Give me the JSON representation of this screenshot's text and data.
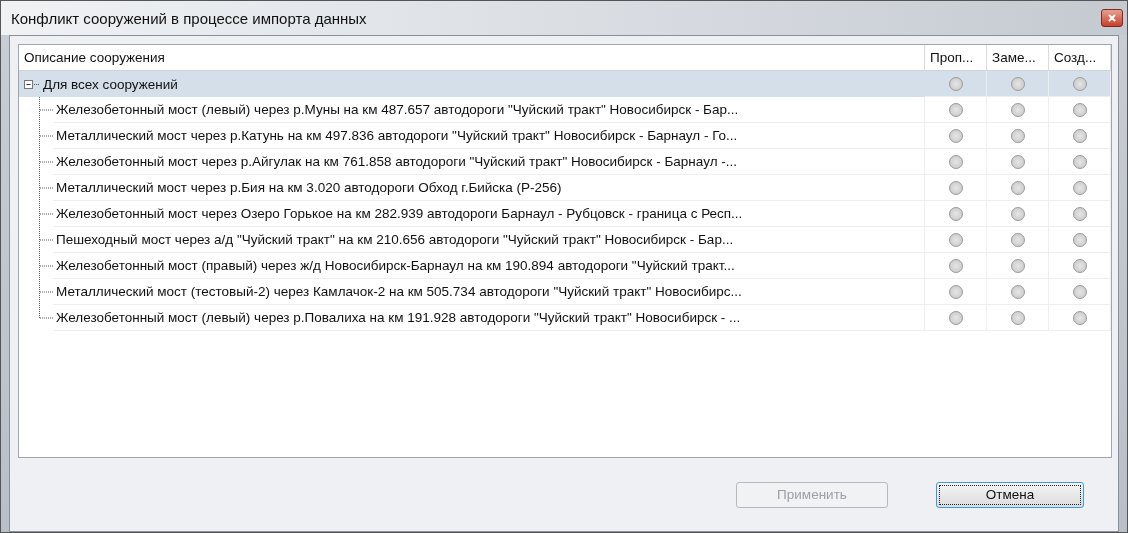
{
  "window": {
    "title": "Конфликт сооружений в процессе импорта данных"
  },
  "table": {
    "columns": [
      "Описание сооружения",
      "Проп...",
      "Заме...",
      "Созд..."
    ],
    "root": {
      "label": "Для всех сооружений",
      "expanded": true,
      "selected": true,
      "options": [
        {
          "selected": false
        },
        {
          "selected": false
        },
        {
          "selected": false
        }
      ],
      "children": [
        {
          "label": "Железобетонный мост (левый) через р.Муны на км 487.657 автодороги \"Чуйский тракт\" Новосибирск - Бар...",
          "options": [
            {
              "selected": false
            },
            {
              "selected": false
            },
            {
              "selected": false
            }
          ]
        },
        {
          "label": "Металлический мост через р.Катунь на км 497.836 автодороги \"Чуйский тракт\" Новосибирск - Барнаул - Го...",
          "options": [
            {
              "selected": false
            },
            {
              "selected": false
            },
            {
              "selected": false
            }
          ]
        },
        {
          "label": "Железобетонный мост через р.Айгулак на км 761.858 автодороги \"Чуйский тракт\" Новосибирск - Барнаул -...",
          "options": [
            {
              "selected": false
            },
            {
              "selected": false
            },
            {
              "selected": false
            }
          ]
        },
        {
          "label": "Металлический мост через р.Бия на км 3.020 автодороги Обход г.Бийска (Р-256)",
          "options": [
            {
              "selected": false
            },
            {
              "selected": false
            },
            {
              "selected": false
            }
          ]
        },
        {
          "label": "Железобетонный мост через Озеро Горькое на км 282.939 автодороги Барнаул - Рубцовск - граница с Респ...",
          "options": [
            {
              "selected": false
            },
            {
              "selected": false
            },
            {
              "selected": false
            }
          ]
        },
        {
          "label": "Пешеходный мост через а/д \"Чуйский тракт\" на км 210.656 автодороги \"Чуйский тракт\" Новосибирск - Бар...",
          "options": [
            {
              "selected": false
            },
            {
              "selected": false
            },
            {
              "selected": false
            }
          ]
        },
        {
          "label": "Железобетонный мост (правый) через ж/д Новосибирск-Барнаул на км 190.894 автодороги \"Чуйский тракт...",
          "options": [
            {
              "selected": false
            },
            {
              "selected": false
            },
            {
              "selected": false
            }
          ]
        },
        {
          "label": "Металлический мост (тестовый-2) через Камлачок-2 на км 505.734 автодороги \"Чуйский тракт\" Новосибирс...",
          "options": [
            {
              "selected": false
            },
            {
              "selected": false
            },
            {
              "selected": false
            }
          ]
        },
        {
          "label": "Железобетонный мост (левый) через р.Повалиха на км 191.928 автодороги \"Чуйский тракт\" Новосибирск - ...",
          "options": [
            {
              "selected": false
            },
            {
              "selected": false
            },
            {
              "selected": false
            }
          ]
        }
      ]
    }
  },
  "buttons": [
    {
      "label": "Применить",
      "disabled": true,
      "focused": false
    },
    {
      "label": "Отмена",
      "disabled": false,
      "focused": true
    }
  ]
}
